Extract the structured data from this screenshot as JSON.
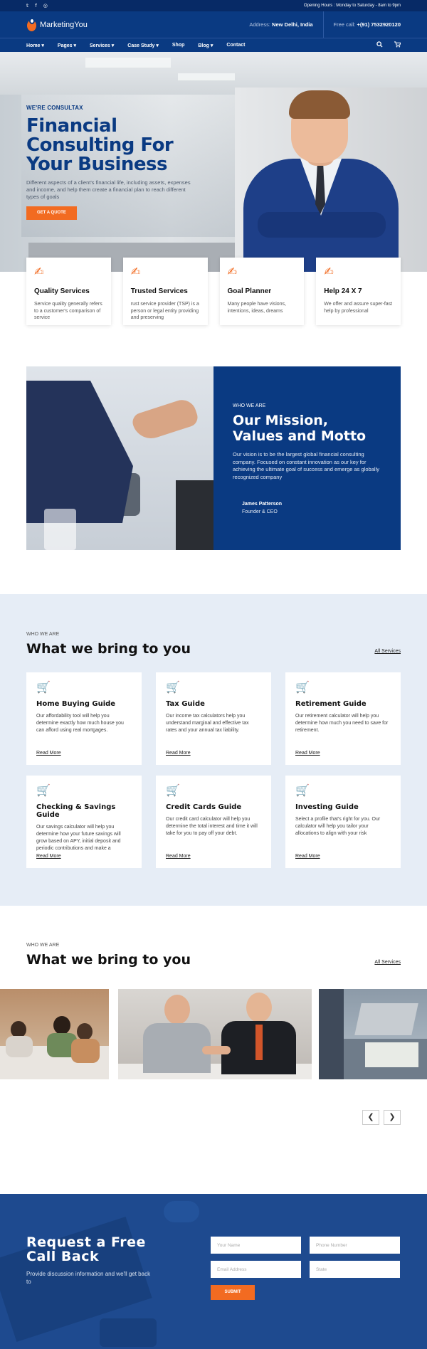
{
  "topbar": {
    "social_icons": [
      "twitter-icon",
      "facebook-icon",
      "instagram-icon"
    ],
    "hours": "Opening Hours : Monday to Saturday - 8am to 9pm"
  },
  "header": {
    "brand": "MarketingYou",
    "address_label": "Address:",
    "address_value": "New Delhi, India",
    "call_label": "Free call:",
    "call_value": "+(91) 7532920120"
  },
  "nav": {
    "items": [
      "Home ▾",
      "Pages ▾",
      "Services ▾",
      "Case Study ▾",
      "Shop",
      "Blog ▾",
      "Contact"
    ],
    "search_icon": "search-icon",
    "cart_icon": "cart-icon"
  },
  "hero": {
    "eyebrow": "WE'RE CONSULTAX",
    "title": "Financial Consulting For Your Business",
    "description": "Different aspects of a client's financial life, including assets, expenses and income, and help them create a financial plan to reach different types of goals",
    "cta": "GET A QUOTE"
  },
  "features": [
    {
      "title": "Quality Services",
      "desc": "Service quality generally refers to a customer's comparison of service"
    },
    {
      "title": "Trusted Services",
      "desc": "rust service provider (TSP) is a person or legal entity providing and preserving"
    },
    {
      "title": "Goal Planner",
      "desc": "Many people have visions, intentions, ideas, dreams"
    },
    {
      "title": "Help 24 X 7",
      "desc": "We offer and assure super-fast help by professional"
    }
  ],
  "mission": {
    "eyebrow": "WHO WE ARE",
    "title_line1": "Our Mission,",
    "title_line2": "Values and Motto",
    "description": "Our vision is to be the largest global financial consulting company. Focused on constant innovation as our key for achieving the ultimate goal of success and emerge as globally recognized company",
    "name": "James Patterson",
    "role": "Founder & CEO"
  },
  "services": {
    "eyebrow": "WHO WE ARE",
    "title": "What we bring to you",
    "link": "All Services",
    "cards": [
      {
        "title": "Home Buying Guide",
        "desc": "Our affordability tool will help you determine exactly how much house you can afford using real mortgages.",
        "more": "Read More"
      },
      {
        "title": "Tax Guide",
        "desc": "Our income tax calculators help you understand marginal and effective tax rates and your annual tax liability.",
        "more": "Read More"
      },
      {
        "title": "Retirement Guide",
        "desc": "Our retirement calculator will help you determine how much you need to save for retirement.",
        "more": "Read More"
      },
      {
        "title": "Checking & Savings Guide",
        "desc": "Our savings calculator will help you determine how your future savings will grow based on APY, initial deposit and periodic contributions and make a",
        "more": "Read More"
      },
      {
        "title": "Credit Cards Guide",
        "desc": "Our credit card calculator will help you determine the total interest and time it will take for you to pay off your debt.",
        "more": "Read More"
      },
      {
        "title": "Investing Guide",
        "desc": "Select a profile that's right for you. Our calculator will help you tailor your allocations to align with your risk",
        "more": "Read More"
      }
    ]
  },
  "gallery": {
    "eyebrow": "WHO WE ARE",
    "title": "What we bring to you",
    "link": "All Services",
    "prev": "❮",
    "next": "❯"
  },
  "callback": {
    "title_line1": "Request a Free",
    "title_line2": "Call Back",
    "description": "Provide discussion information and we'll get back to",
    "name_placeholder": "Your Name",
    "phone_placeholder": "Phone Number",
    "email_placeholder": "Email Address",
    "state_placeholder": "State",
    "submit": "SUBMIT"
  },
  "colors": {
    "navy": "#0a3a82",
    "topbar": "#072a66",
    "orange": "#f26b21",
    "light_bg": "#e6edf6"
  }
}
